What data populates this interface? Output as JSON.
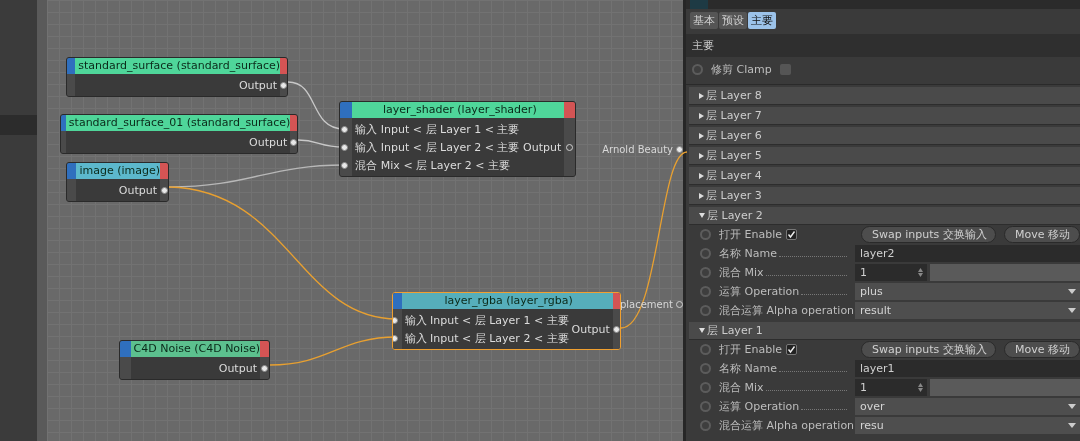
{
  "node_editor": {
    "nodes": [
      {
        "title": "standard_surface (standard_surface)",
        "color": "#4fd69a",
        "selected": false,
        "outputs": [
          {
            "label": "Output",
            "connected": true
          }
        ]
      },
      {
        "title": "standard_surface_01 (standard_surface)",
        "color": "#4fd69a",
        "selected": false,
        "outputs": [
          {
            "label": "Output",
            "connected": true
          }
        ]
      },
      {
        "title": "image (image)",
        "color": "#5cb8cc",
        "selected": false,
        "outputs": [
          {
            "label": "Output",
            "connected": true
          }
        ]
      },
      {
        "title": "layer_shader (layer_shader)",
        "color": "#4fd69a",
        "selected": false,
        "inputs": [
          "输入 Input < 层 Layer 1 < 主要",
          "输入 Input < 层 Layer 2 < 主要",
          "混合 Mix < 层 Layer 2 < 主要"
        ],
        "outputs": [
          {
            "label": "Output",
            "connected": false
          }
        ]
      },
      {
        "title": "layer_rgba (layer_rgba)",
        "color": "#56aebb",
        "selected": true,
        "inputs": [
          "输入 Input < 层 Layer 1 < 主要",
          "输入 Input < 层 Layer 2 < 主要"
        ],
        "outputs": [
          {
            "label": "Output",
            "connected": true
          }
        ]
      },
      {
        "title": "C4D Noise (C4D Noise)",
        "color": "#5cc08e",
        "selected": false,
        "outputs": [
          {
            "label": "Output",
            "connected": true
          }
        ]
      }
    ],
    "scene_ports": [
      {
        "label": "Arnold Beauty",
        "connected": true
      },
      {
        "label": "placement",
        "connected": false
      }
    ]
  },
  "attributes": {
    "tabs": [
      {
        "label": "基本",
        "selected": false
      },
      {
        "label": "预设",
        "selected": false
      },
      {
        "label": "主要",
        "selected": true
      }
    ],
    "section": "主要",
    "clamp": {
      "label": "修剪 Clamp",
      "checked": false
    },
    "layers": [
      {
        "label": "层 Layer 8",
        "expanded": false
      },
      {
        "label": "层 Layer 7",
        "expanded": false
      },
      {
        "label": "层 Layer 6",
        "expanded": false
      },
      {
        "label": "层 Layer 5",
        "expanded": false
      },
      {
        "label": "层 Layer 4",
        "expanded": false
      },
      {
        "label": "层 Layer 3",
        "expanded": false
      },
      {
        "label": "层 Layer 2",
        "expanded": true,
        "enable": {
          "label": "打开 Enable",
          "checked": true
        },
        "buttons": [
          "Swap inputs 交换输入",
          "Move 移动"
        ],
        "fields": [
          {
            "kind": "text",
            "label": "名称 Name",
            "value": "layer2"
          },
          {
            "kind": "number",
            "label": "混合 Mix",
            "value": "1"
          },
          {
            "kind": "dropdown",
            "label": "运算 Operation",
            "value": "plus"
          },
          {
            "kind": "dropdown",
            "label": "混合运算 Alpha operation",
            "value": "result"
          }
        ]
      },
      {
        "label": "层 Layer 1",
        "expanded": true,
        "enable": {
          "label": "打开 Enable",
          "checked": true
        },
        "buttons": [
          "Swap inputs 交换输入",
          "Move 移动"
        ],
        "fields": [
          {
            "kind": "text",
            "label": "名称 Name",
            "value": "layer1"
          },
          {
            "kind": "number",
            "label": "混合 Mix",
            "value": "1"
          },
          {
            "kind": "dropdown",
            "label": "运算 Operation",
            "value": "over"
          },
          {
            "kind": "dropdown",
            "label": "混合运算 Alpha operation",
            "value": "resu"
          }
        ]
      }
    ]
  }
}
